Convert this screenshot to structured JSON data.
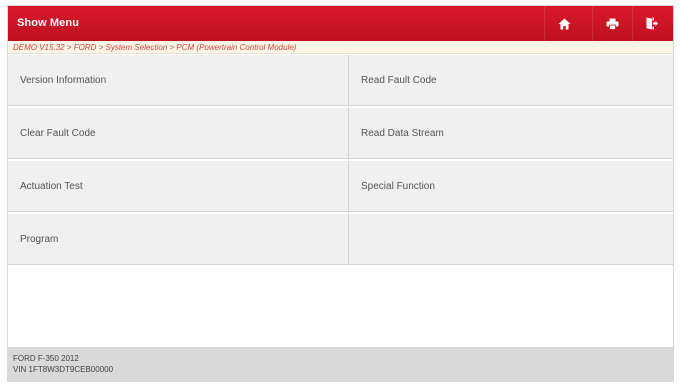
{
  "header": {
    "title": "Show Menu",
    "buttons": [
      {
        "name": "home-button",
        "icon": "home-icon"
      },
      {
        "name": "print-button",
        "icon": "printer-icon"
      },
      {
        "name": "exit-button",
        "icon": "exit-icon"
      }
    ]
  },
  "breadcrumb": {
    "text": "DEMO V15.32 > FORD > System Selection > PCM (Powertrain Control Module)"
  },
  "menu": {
    "items": [
      {
        "label": "Version Information"
      },
      {
        "label": "Read Fault Code"
      },
      {
        "label": "Clear Fault Code"
      },
      {
        "label": "Read Data Stream"
      },
      {
        "label": "Actuation Test"
      },
      {
        "label": "Special Function"
      },
      {
        "label": "Program"
      },
      {
        "label": ""
      }
    ]
  },
  "footer": {
    "vehicle": "FORD F-350 2012",
    "vin": "VIN 1FT8W3DT9CEB00000"
  },
  "colors": {
    "titlebar": "#c8142a",
    "breadcrumb_text": "#d9453a",
    "cell_bg": "#f0f0f0",
    "footer_bg": "#d9d9d9"
  }
}
